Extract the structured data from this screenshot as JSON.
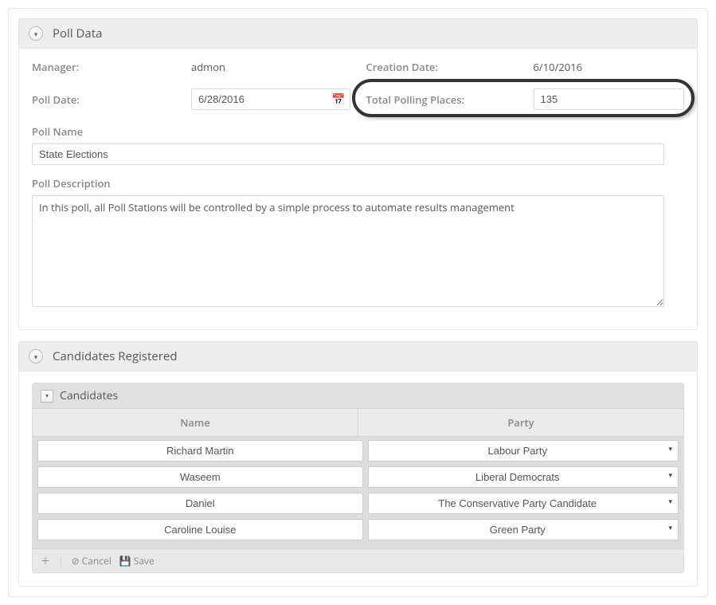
{
  "panels": {
    "poll_data": {
      "title": "Poll Data"
    },
    "candidates_registered": {
      "title": "Candidates Registered"
    },
    "candidates_sub": {
      "title": "Candidates"
    }
  },
  "labels": {
    "manager": "Manager:",
    "creation_date": "Creation Date:",
    "poll_date": "Poll Date:",
    "total_polling_places": "Total Polling Places:",
    "poll_name": "Poll Name",
    "poll_description": "Poll Description"
  },
  "values": {
    "manager": "admon",
    "creation_date": "6/10/2016",
    "poll_date": "6/28/2016",
    "total_polling_places": "135",
    "poll_name": "State Elections",
    "poll_description": "In this poll, all Poll Stations will be controlled by a simple process to automate results management"
  },
  "grid": {
    "headers": {
      "name": "Name",
      "party": "Party"
    },
    "rows": [
      {
        "name": "Richard Martin",
        "party": "Labour Party"
      },
      {
        "name": "Waseem",
        "party": "Liberal Democrats"
      },
      {
        "name": "Daniel",
        "party": "The Conservative Party Candidate"
      },
      {
        "name": "Caroline Louise",
        "party": "Green Party"
      }
    ],
    "footer": {
      "cancel": "Cancel",
      "save": "Save"
    }
  }
}
